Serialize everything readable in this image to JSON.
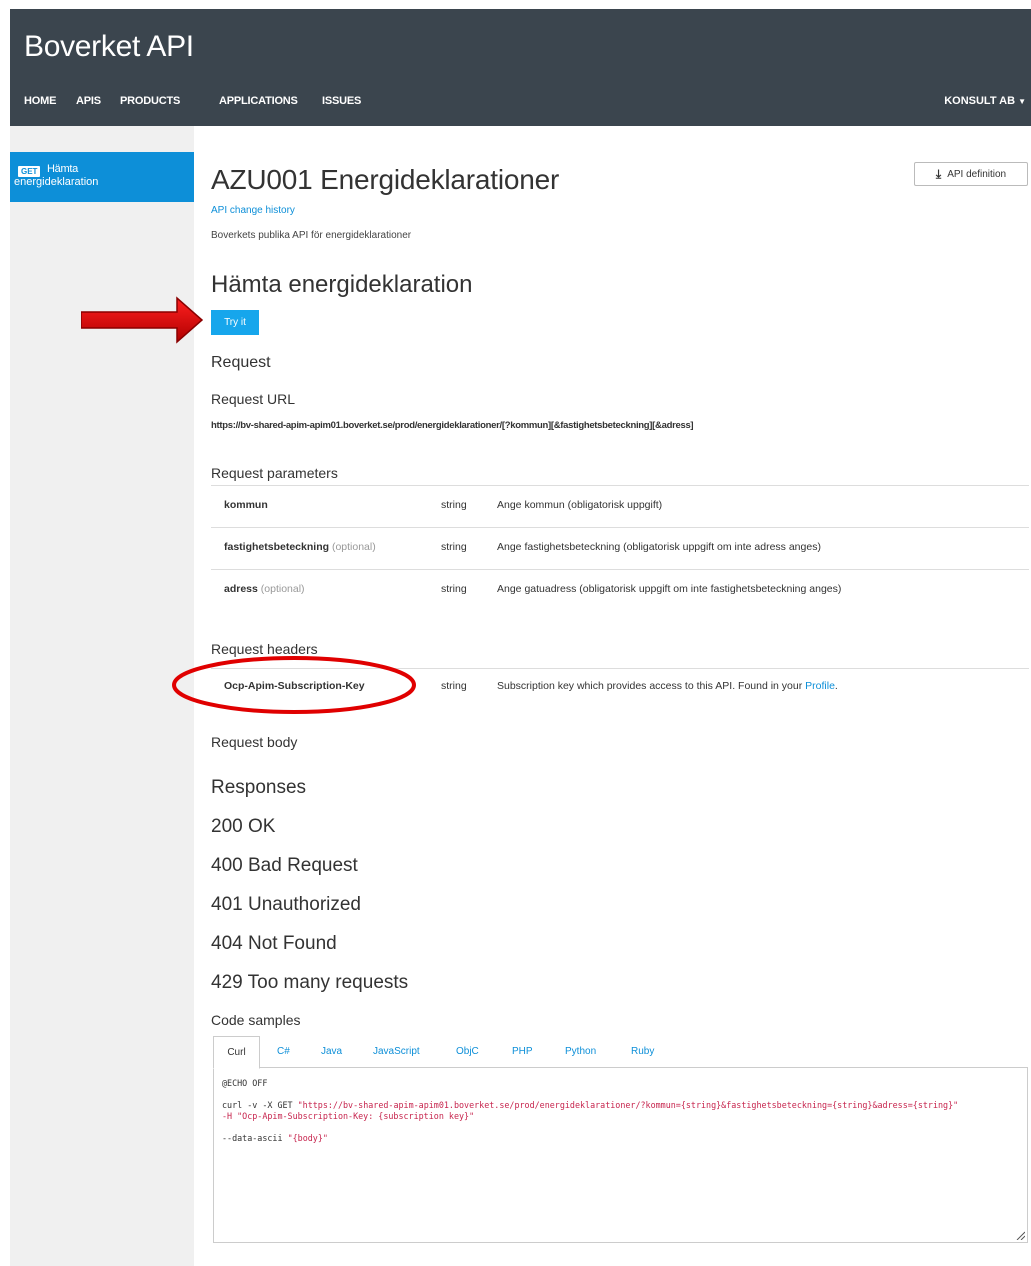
{
  "header": {
    "brand": "Boverket API",
    "nav": [
      "HOME",
      "APIS",
      "PRODUCTS",
      "APPLICATIONS",
      "ISSUES"
    ],
    "user": "KONSULT AB"
  },
  "sidebar": {
    "items": [
      {
        "method": "GET",
        "label_line1": "Hämta",
        "label_line2": "energideklaration"
      }
    ]
  },
  "api": {
    "title": "AZU001 Energideklarationer",
    "change_history": "API change history",
    "description": "Boverkets publika API för energideklarationer",
    "definition_button": "API definition"
  },
  "operation": {
    "title": "Hämta energideklaration",
    "try_button": "Try it",
    "request_heading": "Request",
    "request_url_heading": "Request URL",
    "request_url": "https://bv-shared-apim-apim01.boverket.se/prod/energideklarationer/[?kommun][&fastighetsbeteckning][&adress]",
    "request_parameters_heading": "Request parameters",
    "parameters": [
      {
        "name": "kommun",
        "optional": "",
        "type": "string",
        "description": "Ange kommun (obligatorisk uppgift)"
      },
      {
        "name": "fastighetsbeteckning",
        "optional": "(optional)",
        "type": "string",
        "description": "Ange fastighetsbeteckning (obligatorisk uppgift om inte adress anges)"
      },
      {
        "name": "adress",
        "optional": "(optional)",
        "type": "string",
        "description": "Ange gatuadress (obligatorisk uppgift om inte fastighetsbeteckning anges)"
      }
    ],
    "request_headers_heading": "Request headers",
    "headers": [
      {
        "name": "Ocp-Apim-Subscription-Key",
        "type": "string",
        "description": "Subscription key which provides access to this API. Found in your ",
        "link": "Profile",
        "suffix": "."
      }
    ],
    "request_body_heading": "Request body",
    "responses_heading": "Responses",
    "responses": [
      "200 OK",
      "400 Bad Request",
      "401 Unauthorized",
      "404 Not Found",
      "429 Too many requests"
    ],
    "code_samples_heading": "Code samples",
    "code_tabs": [
      "Curl",
      "C#",
      "Java",
      "JavaScript",
      "ObjC",
      "PHP",
      "Python",
      "Ruby"
    ],
    "code": {
      "line1": "@ECHO OFF",
      "line2a": "curl -v -X GET ",
      "line2b": "\"https://bv-shared-apim-apim01.boverket.se/prod/energideklarationer/?kommun={string}&fastighetsbeteckning={string}&adress={string}\"",
      "line3": "-H \"Ocp-Apim-Subscription-Key: {subscription key}\"",
      "line4a": "--data-ascii ",
      "line4b": "\"{body}\""
    }
  },
  "colors": {
    "header_bg": "#3b454e",
    "accent": "#0d8fd8",
    "try_button": "#16a6ec",
    "annotation": "#e00000"
  }
}
